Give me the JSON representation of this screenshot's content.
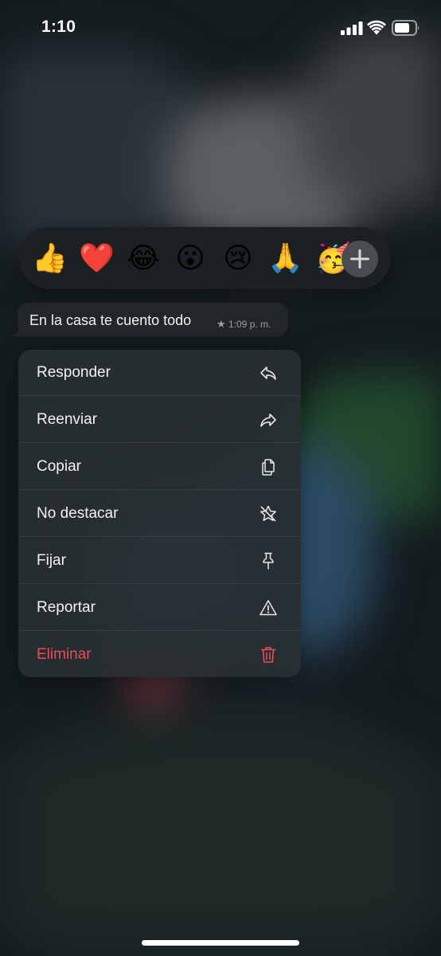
{
  "status_bar": {
    "time": "1:10"
  },
  "reactions": {
    "emojis": [
      "👍",
      "❤️",
      "😂",
      "😮",
      "😢",
      "🙏",
      "🥳"
    ],
    "plus_label": "+"
  },
  "message": {
    "text": "En la casa te cuento todo",
    "star": "★",
    "time": "1:09 p. m."
  },
  "menu": {
    "items": [
      {
        "label": "Responder",
        "icon": "reply-icon"
      },
      {
        "label": "Reenviar",
        "icon": "forward-icon"
      },
      {
        "label": "Copiar",
        "icon": "copy-icon"
      },
      {
        "label": "No destacar",
        "icon": "unstar-icon"
      },
      {
        "label": "Fijar",
        "icon": "pin-icon"
      },
      {
        "label": "Reportar",
        "icon": "warning-icon"
      },
      {
        "label": "Eliminar",
        "icon": "trash-icon"
      }
    ]
  },
  "colors": {
    "danger": "#ea4a5a",
    "menu_bg": "#2a3034",
    "bubble_bg": "#232628"
  }
}
